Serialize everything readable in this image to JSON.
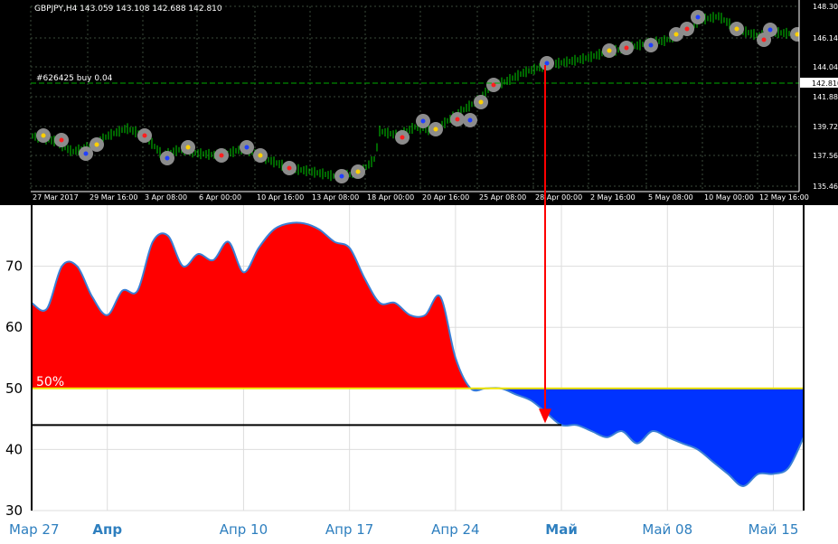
{
  "top_chart": {
    "symbol_line": "GBPJPY,H4  143.059 143.108 142.688 142.810",
    "order_label": "#626425 buy 0.04",
    "current_price_label": "142.810",
    "y_ticks": [
      "148.300",
      "146.140",
      "144.040",
      "141.880",
      "139.720",
      "137.560",
      "135.460"
    ],
    "x_ticks": [
      "27 Mar 2017",
      "29 Mar 16:00",
      "3 Apr 08:00",
      "6 Apr 00:00",
      "10 Apr 16:00",
      "13 Apr 08:00",
      "18 Apr 00:00",
      "20 Apr 16:00",
      "25 Apr 08:00",
      "28 Apr 00:00",
      "2 May 16:00",
      "5 May 08:00",
      "10 May 00:00",
      "12 May 16:00"
    ],
    "colors": {
      "background": "#000000",
      "candles": "#00cc00",
      "grid": "#3a4a3a",
      "order_line": "#00aa00",
      "text": "#ffffff"
    }
  },
  "chart_data": {
    "type": "area",
    "x": [
      "2017-03-27",
      "2017-03-28",
      "2017-03-29",
      "2017-03-30",
      "2017-03-31",
      "2017-04-01",
      "2017-04-02",
      "2017-04-03",
      "2017-04-04",
      "2017-04-05",
      "2017-04-06",
      "2017-04-07",
      "2017-04-08",
      "2017-04-09",
      "2017-04-10",
      "2017-04-11",
      "2017-04-12",
      "2017-04-13",
      "2017-04-14",
      "2017-04-15",
      "2017-04-16",
      "2017-04-17",
      "2017-04-18",
      "2017-04-19",
      "2017-04-20",
      "2017-04-21",
      "2017-04-22",
      "2017-04-23",
      "2017-04-24",
      "2017-04-25",
      "2017-04-26",
      "2017-04-27",
      "2017-04-28",
      "2017-04-29",
      "2017-04-30",
      "2017-05-01",
      "2017-05-02",
      "2017-05-03",
      "2017-05-04",
      "2017-05-05",
      "2017-05-06",
      "2017-05-07",
      "2017-05-08",
      "2017-05-09",
      "2017-05-10",
      "2017-05-11",
      "2017-05-12",
      "2017-05-13",
      "2017-05-14",
      "2017-05-15",
      "2017-05-16",
      "2017-05-17"
    ],
    "values": [
      64,
      63,
      70,
      70,
      65,
      62,
      66,
      66,
      74,
      75,
      70,
      72,
      71,
      74,
      69,
      73,
      76,
      77,
      77,
      76,
      74,
      73,
      68,
      64,
      64,
      62,
      62,
      65,
      55,
      50,
      50,
      50,
      49,
      48,
      46,
      44,
      44,
      43,
      42,
      43,
      41,
      43,
      42,
      41,
      40,
      38,
      36,
      34,
      36,
      36,
      37,
      42
    ],
    "y_ticks": [
      "30",
      "40",
      "50",
      "60",
      "70"
    ],
    "x_ticks": [
      {
        "date": "2017-03-27",
        "label": "Мар 27",
        "bold": false
      },
      {
        "date": "2017-04-01",
        "label": "Апр",
        "bold": true
      },
      {
        "date": "2017-04-10",
        "label": "Апр 10",
        "bold": false
      },
      {
        "date": "2017-04-17",
        "label": "Апр 17",
        "bold": false
      },
      {
        "date": "2017-04-24",
        "label": "Апр 24",
        "bold": false
      },
      {
        "date": "2017-05-01",
        "label": "Май",
        "bold": true
      },
      {
        "date": "2017-05-08",
        "label": "Май 08",
        "bold": false
      },
      {
        "date": "2017-05-15",
        "label": "Май 15",
        "bold": false
      }
    ],
    "ylim": [
      30,
      80
    ],
    "baseline": 50,
    "baseline_label": "50%",
    "marker_value": 44,
    "marker_date": "2017-05-01",
    "grid": true,
    "colors": {
      "above": "#ff0000",
      "below": "#0033ff",
      "line": "#3a7fd5",
      "baseline": "#f2e600",
      "marker": "#000000",
      "arrow": "#ff0000"
    }
  }
}
